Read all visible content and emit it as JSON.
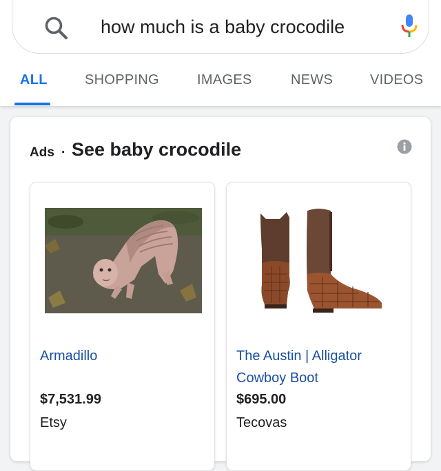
{
  "search": {
    "query": "how much is a baby crocodile"
  },
  "tabs": [
    {
      "label": "ALL",
      "active": true
    },
    {
      "label": "SHOPPING",
      "active": false
    },
    {
      "label": "IMAGES",
      "active": false
    },
    {
      "label": "NEWS",
      "active": false
    },
    {
      "label": "VIDEOS",
      "active": false
    }
  ],
  "ads": {
    "label": "Ads",
    "separator": "·",
    "title": "See baby crocodile",
    "products": [
      {
        "title": "Armadillo",
        "price": "$7,531.99",
        "seller": "Etsy",
        "image_icon": "creature-photo"
      },
      {
        "title": "The Austin | Alligator Cowboy Boot",
        "price": "$695.00",
        "seller": "Tecovas",
        "image_icon": "cowboy-boots-photo"
      }
    ]
  },
  "colors": {
    "accent": "#1a73e8",
    "link": "#1a4fa0",
    "tab_inactive": "#5f6368",
    "text": "#202124"
  },
  "icons": {
    "search": "search-icon",
    "mic": "mic-icon",
    "info": "info-icon"
  }
}
